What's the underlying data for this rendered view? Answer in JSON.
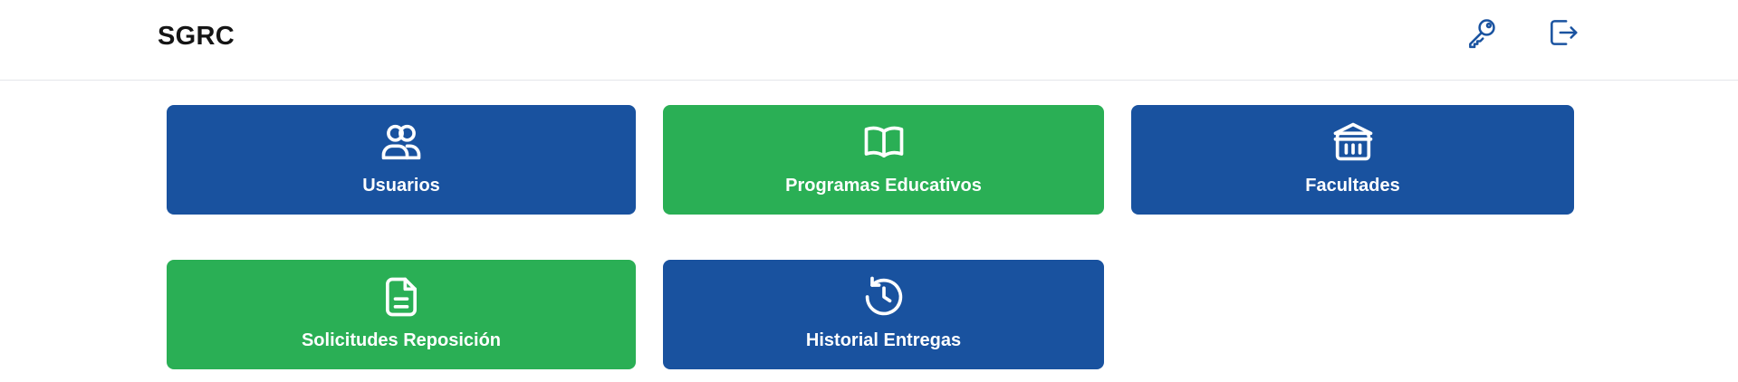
{
  "navbar": {
    "brand": "SGRC",
    "icons": [
      "key-icon",
      "logout-icon"
    ]
  },
  "tiles": [
    {
      "label": "Usuarios",
      "icon": "users-icon",
      "color": "#19529f"
    },
    {
      "label": "Programas Educativos",
      "icon": "book-open-icon",
      "color": "#2aaf55"
    },
    {
      "label": "Facultades",
      "icon": "building-columns-icon",
      "color": "#19529f"
    },
    {
      "label": "Solicitudes Reposición",
      "icon": "document-icon",
      "color": "#2aaf55"
    },
    {
      "label": "Historial Entregas",
      "icon": "history-clock-icon",
      "color": "#19529f"
    }
  ],
  "colors": {
    "primary_blue": "#19529f",
    "primary_green": "#2aaf55",
    "nav_icon": "#1a53a0"
  }
}
